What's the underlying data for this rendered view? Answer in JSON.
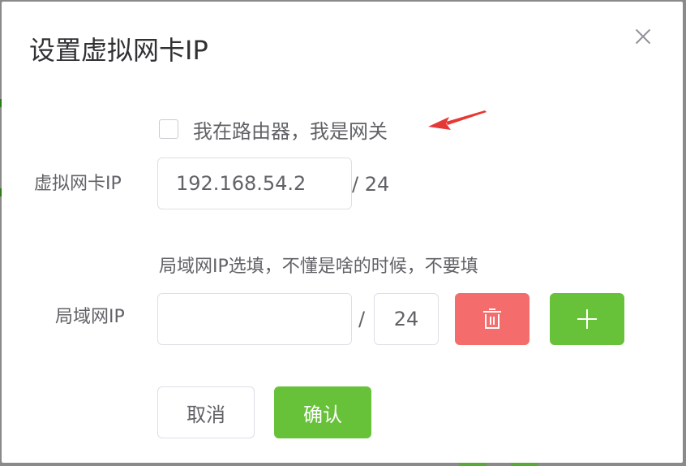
{
  "dialog": {
    "title": "设置虚拟网卡IP",
    "close_icon": "close-icon"
  },
  "gateway": {
    "checked": false,
    "label": "我在路由器，我是网关"
  },
  "virtual_nic": {
    "label": "虚拟网卡IP",
    "ip_value": "192.168.54.2",
    "mask_text": "/ 24"
  },
  "lan": {
    "hint": "局域网IP选填，不懂是啥的时候，不要填",
    "label": "局域网IP",
    "ip_value": "",
    "slash": "/",
    "mask_value": "24",
    "delete_icon": "trash-icon",
    "add_icon": "plus-icon"
  },
  "footer": {
    "cancel_label": "取消",
    "confirm_label": "确认"
  },
  "colors": {
    "danger": "#f56c6c",
    "success": "#67c23a",
    "annotation_arrow": "#e53935"
  }
}
